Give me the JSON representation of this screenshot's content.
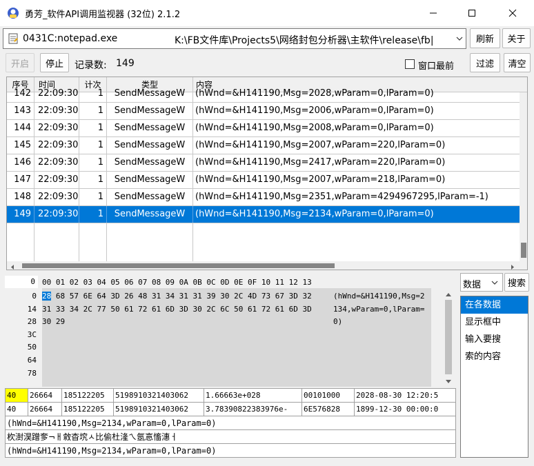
{
  "window": {
    "title": "勇芳_软件API调用监视器 (32位) 2.1.2",
    "minimize_icon": "minimize-icon",
    "maximize_icon": "maximize-icon",
    "close_icon": "close-icon"
  },
  "process": {
    "name": "0431C:notepad.exe",
    "path": "K:\\FB文件库\\Projects5\\网络封包分析器\\主软件\\release\\fb|"
  },
  "toolbar": {
    "refresh": "刷新",
    "close": "关于",
    "start": "开启",
    "stop": "停止",
    "record_label": "记录数:",
    "record_count": "149",
    "topmost": "窗口最前",
    "filter": "过滤",
    "clear": "清空"
  },
  "grid": {
    "headers": [
      "序号",
      "时间",
      "计次",
      "类型",
      "内容"
    ],
    "rows": [
      {
        "id": "142",
        "time": "22:09:30",
        "count": "1",
        "type": "SendMessageW",
        "content": "(hWnd=&H141190,Msg=2028,wParam=0,lParam=0)",
        "partial": true
      },
      {
        "id": "143",
        "time": "22:09:30",
        "count": "1",
        "type": "SendMessageW",
        "content": "(hWnd=&H141190,Msg=2006,wParam=0,lParam=0)"
      },
      {
        "id": "144",
        "time": "22:09:30",
        "count": "1",
        "type": "SendMessageW",
        "content": "(hWnd=&H141190,Msg=2008,wParam=0,lParam=0)"
      },
      {
        "id": "145",
        "time": "22:09:30",
        "count": "1",
        "type": "SendMessageW",
        "content": "(hWnd=&H141190,Msg=2007,wParam=220,lParam=0)"
      },
      {
        "id": "146",
        "time": "22:09:30",
        "count": "1",
        "type": "SendMessageW",
        "content": "(hWnd=&H141190,Msg=2417,wParam=220,lParam=0)"
      },
      {
        "id": "147",
        "time": "22:09:30",
        "count": "1",
        "type": "SendMessageW",
        "content": "(hWnd=&H141190,Msg=2007,wParam=218,lParam=0)"
      },
      {
        "id": "148",
        "time": "22:09:30",
        "count": "1",
        "type": "SendMessageW",
        "content": "(hWnd=&H141190,Msg=2351,wParam=4294967295,lParam=-1)"
      },
      {
        "id": "149",
        "time": "22:09:30",
        "count": "1",
        "type": "SendMessageW",
        "content": "(hWnd=&H141190,Msg=2134,wParam=0,lParam=0)",
        "selected": true
      }
    ]
  },
  "hex": {
    "offset_header": "0",
    "column_header": "00 01 02 03 04 05 06 07 08 09 0A 0B 0C 0D 0E 0F 10 11 12 13",
    "offsets": [
      "0",
      "14",
      "28",
      "3C",
      "50",
      "64",
      "78"
    ],
    "selected_byte": "28",
    "line0_rest": "68 57 6E 64 3D 26 48 31 34 31 31 39 30 2C 4D 73 67 3D 32",
    "line1": "31 33 34 2C 77 50 61 72 61 6D 3D 30 2C 6C 50 61 72 61 6D 3D",
    "line2": "30 29",
    "ascii": [
      "(hWnd=&H141190,Msg=2",
      "134,wParam=0,lParam=",
      "0)"
    ]
  },
  "values": {
    "row1": [
      "40",
      "26664",
      "185122205",
      "5198910321403062",
      "1.66663e+028",
      "00101000",
      "2028-08-30 12:20:5"
    ],
    "row2": [
      "40",
      "26664",
      "185122205",
      "5198910321403062",
      "3.78390822383976e-",
      "6E576828",
      "1899-12-30 00:00:0"
    ],
    "text1": "(hWnd=&H141190,Msg=2134,wParam=0,lParam=0)",
    "text2": "杴澍淏蹭奓¬ㅐ敹杳㙀ㅅ⽐偷杜湰ㄟ氬悥慉潓ㅓ",
    "text3": "(hWnd=&H141190,Msg=2134,wParam=0,lParam=0)"
  },
  "search": {
    "type": "数据",
    "button": "搜索",
    "items": [
      "在各数据",
      "显示框中",
      "输入要搜",
      "索的内容"
    ]
  },
  "colors": {
    "selection": "#0078d7",
    "highlight_byte": "#0078d7",
    "yellow_cell": "#ffff00"
  }
}
